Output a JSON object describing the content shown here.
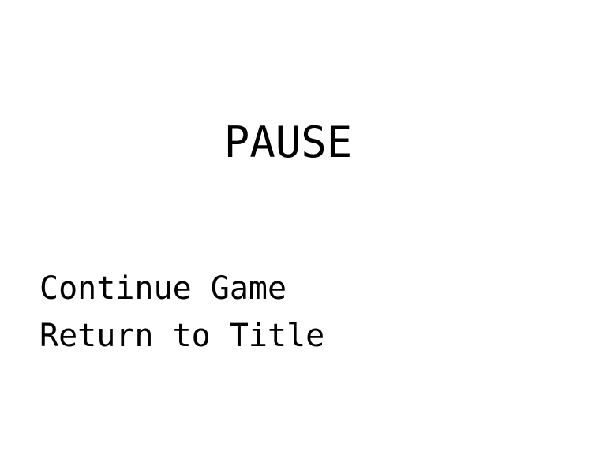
{
  "pause_screen": {
    "title": "PAUSE",
    "menu": [
      {
        "label": "Continue Game"
      },
      {
        "label": "Return to Title"
      }
    ]
  },
  "colors": {
    "background": "#ffffff",
    "text": "#000000"
  }
}
